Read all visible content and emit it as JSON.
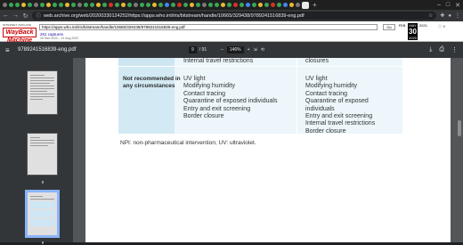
{
  "browser": {
    "url": "web.archive.org/web/20200330124252/https://apps.who.int/iris/bitstream/handle/10665/329438/9789241516839-eng.pdf"
  },
  "wayback": {
    "logo_top": "INTERNET ARCHIVE",
    "logo_main": "WayBack Machine",
    "url_field": "https://apps.who.int/iris/bitstream/handle/10665/329438/9789241516839-eng.pdf",
    "captures": "261 captures",
    "date_range": "30 Mar 2020 – 21 Aug 2022",
    "go_label": "Go",
    "cal_prev": "FEB",
    "cal_cur_month": "MAY",
    "cal_day": "30",
    "cal_year": "2020",
    "cal_next": "2021"
  },
  "pdf": {
    "filename": "9789241516839-eng.pdf",
    "current_page": "9",
    "total_pages": "/ 91",
    "zoom": "146%",
    "zoom_minus": "–",
    "zoom_plus": "+"
  },
  "thumbnails": [
    {
      "number": ""
    },
    {
      "number": "8"
    },
    {
      "number": "9"
    }
  ],
  "table": {
    "top_col1": "Internal travel restrictions",
    "top_col2": "closures",
    "row_label_line1": "Not recommended in",
    "row_label_line2": "any circumstances",
    "col1": [
      "UV light",
      "Modifying humidity",
      "Contact tracing",
      "Quarantine of exposed individuals",
      "Entry and exit screening",
      "Border closure"
    ],
    "col2": [
      "UV light",
      "Modifying humidity",
      "Contact tracing",
      "Quarantine of exposed",
      "individuals",
      "Entry and exit screening",
      "Internal travel restrictions",
      "Border closure"
    ]
  },
  "footnote": "NPI: non-pharmaceutical intervention; UV: ultraviolet."
}
